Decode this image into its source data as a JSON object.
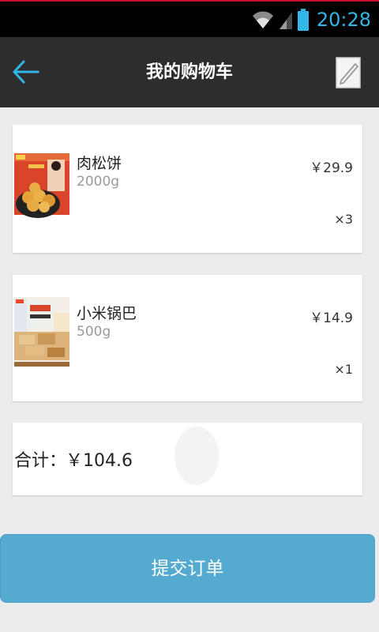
{
  "status_bar": {
    "time": "20:28",
    "wifi_icon": "wifi-icon",
    "signal_icon": "signal-icon",
    "battery_icon": "battery-icon",
    "accent_color": "#33b5e5"
  },
  "app_bar": {
    "title": "我的购物车",
    "back_icon": "back-arrow-icon",
    "edit_icon": "edit-icon",
    "background": "#2d2d2d"
  },
  "cart": {
    "items": [
      {
        "name": "肉松饼",
        "weight": "2000g",
        "price": "￥29.9",
        "quantity": "×3"
      },
      {
        "name": "小米锅巴",
        "weight": "500g",
        "price": "￥14.9",
        "quantity": "×1"
      }
    ],
    "total_label": "合计：",
    "total_value": "￥104.6"
  },
  "submit_button": {
    "label": "提交订单",
    "color": "#55aad0"
  }
}
